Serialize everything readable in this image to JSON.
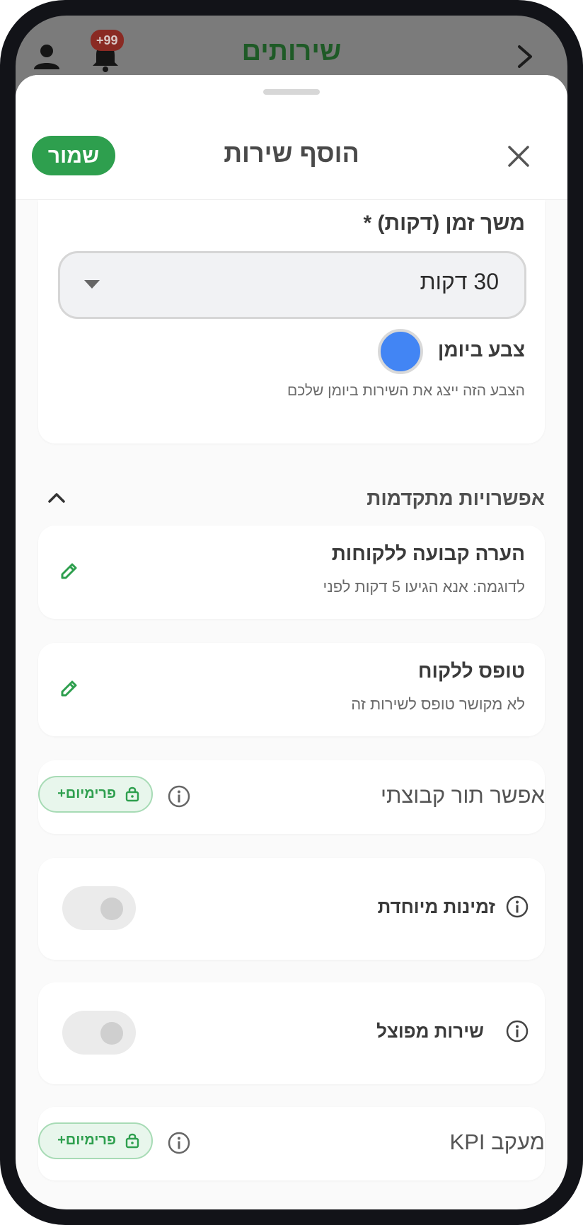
{
  "app_header": {
    "title": "שירותים",
    "notification_badge": "+99",
    "icons": [
      "back-chevron-icon",
      "bell-icon",
      "user-icon"
    ]
  },
  "sheet": {
    "title": "הוסף שירות",
    "save_label": "שמור",
    "icons": [
      "close-icon"
    ]
  },
  "duration": {
    "label": "משך זמן (דקות) *",
    "value": "30 דקות"
  },
  "calendar_color": {
    "label": "צבע ביומן",
    "hint": "הצבע הזה ייצג את השירות ביומן שלכם",
    "color": "#4285f4"
  },
  "advanced": {
    "title": "אפשרויות מתקדמות",
    "expanded": true
  },
  "customer_note": {
    "title": "הערה קבועה ללקוחות",
    "placeholder": "לדוגמה: אנא הגיעו 5 דקות לפני"
  },
  "customer_form": {
    "title": "טופס ללקוח",
    "value": "לא מקושר טופס לשירות זה"
  },
  "group_booking": {
    "label": "אפשר תור קבוצתי",
    "premium_label": "פרימיום+"
  },
  "special_availability": {
    "label": "זמינות מיוחדת",
    "enabled": false
  },
  "split_service": {
    "label": "שירות מפוצל",
    "enabled": false
  },
  "kpi_tracking": {
    "label": "מעקב KPI",
    "premium_label": "פרימיום+"
  },
  "colors": {
    "accent": "#2e9f4e",
    "premium_bg": "#e8f6ec"
  }
}
